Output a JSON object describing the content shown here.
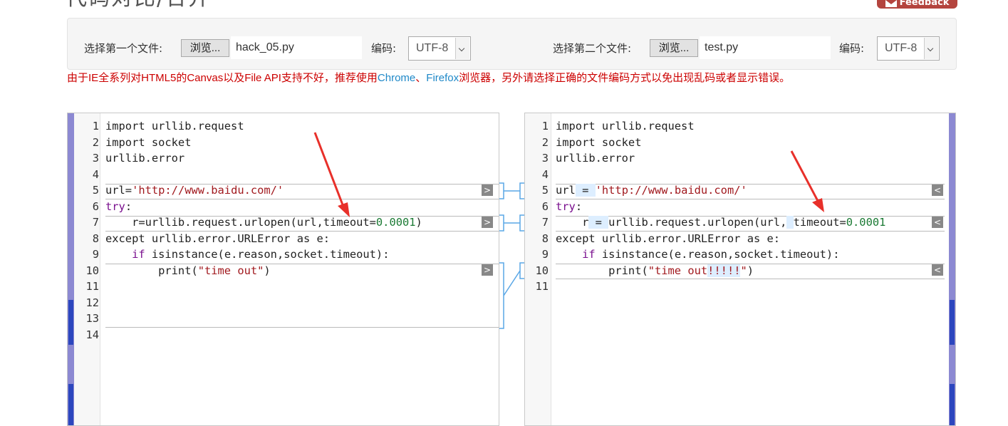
{
  "header": {
    "title": "代码对比/合并",
    "feedback_label": "Feedback"
  },
  "toolbar": {
    "file1": {
      "label": "选择第一个文件:",
      "browse_label": "浏览...",
      "filename": "hack_05.py",
      "encoding_label": "编码:",
      "encoding_value": "UTF-8"
    },
    "file2": {
      "label": "选择第二个文件:",
      "browse_label": "浏览...",
      "filename": "test.py",
      "encoding_label": "编码:",
      "encoding_value": "UTF-8"
    }
  },
  "notice": {
    "part1": "由于IE全系列对HTML5的Canvas以及File API支持不好，推荐使用",
    "chrome": "Chrome",
    "sep": "、",
    "firefox": "Firefox",
    "part2": "浏览器，另外请选择正确的文件编码方式以免出现乱码或者显示错误。"
  },
  "left_pane": {
    "line_numbers": [
      "1",
      "2",
      "3",
      "4",
      "5",
      "6",
      "7",
      "8",
      "9",
      "10",
      "11",
      "12",
      "13",
      "14"
    ],
    "merge_button": ">"
  },
  "right_pane": {
    "line_numbers": [
      "1",
      "2",
      "3",
      "4",
      "5",
      "6",
      "7",
      "8",
      "9",
      "10",
      "11"
    ],
    "merge_button": "<"
  },
  "code": {
    "left": {
      "l1": "import urllib.request",
      "l2": "import socket",
      "l3": "urllib.error",
      "l5a": "url=",
      "l5b": "'http://www.baidu.com/'",
      "l6a": "try",
      "l6b": ":",
      "l7a": "    r=urllib.request.urlopen(url,timeout=",
      "l7b": "0.0001",
      "l7c": ")",
      "l8": "except urllib.error.URLError as e:",
      "l9a": "    ",
      "l9b": "if",
      "l9c": " isinstance(e.reason,socket.timeout):",
      "l10a": "        print(",
      "l10b": "\"time out\"",
      "l10c": ")"
    },
    "right": {
      "l1": "import urllib.request",
      "l2": "import socket",
      "l3": "urllib.error",
      "l5a": "url",
      "l5b": " = ",
      "l5c": "'http://www.baidu.com/'",
      "l6a": "try",
      "l6b": ":",
      "l7a": "    r",
      "l7b": " = ",
      "l7c": "urllib.request.urlopen(url,",
      "l7d": " ",
      "l7e": "timeout=",
      "l7f": "0.0001",
      "l8": "except urllib.error.URLError as e:",
      "l9a": "    ",
      "l9b": "if",
      "l9c": " isinstance(e.reason,socket.timeout):",
      "l10a": "        print(",
      "l10b": "\"time out",
      "l10c": "!!!!!",
      "l10d": "\"",
      "l10e": ")"
    }
  },
  "colors": {
    "annotation_arrow": "#e8302a",
    "connector": "#5aa7e6",
    "notice": "#cc0000",
    "link": "#1e88c8"
  }
}
